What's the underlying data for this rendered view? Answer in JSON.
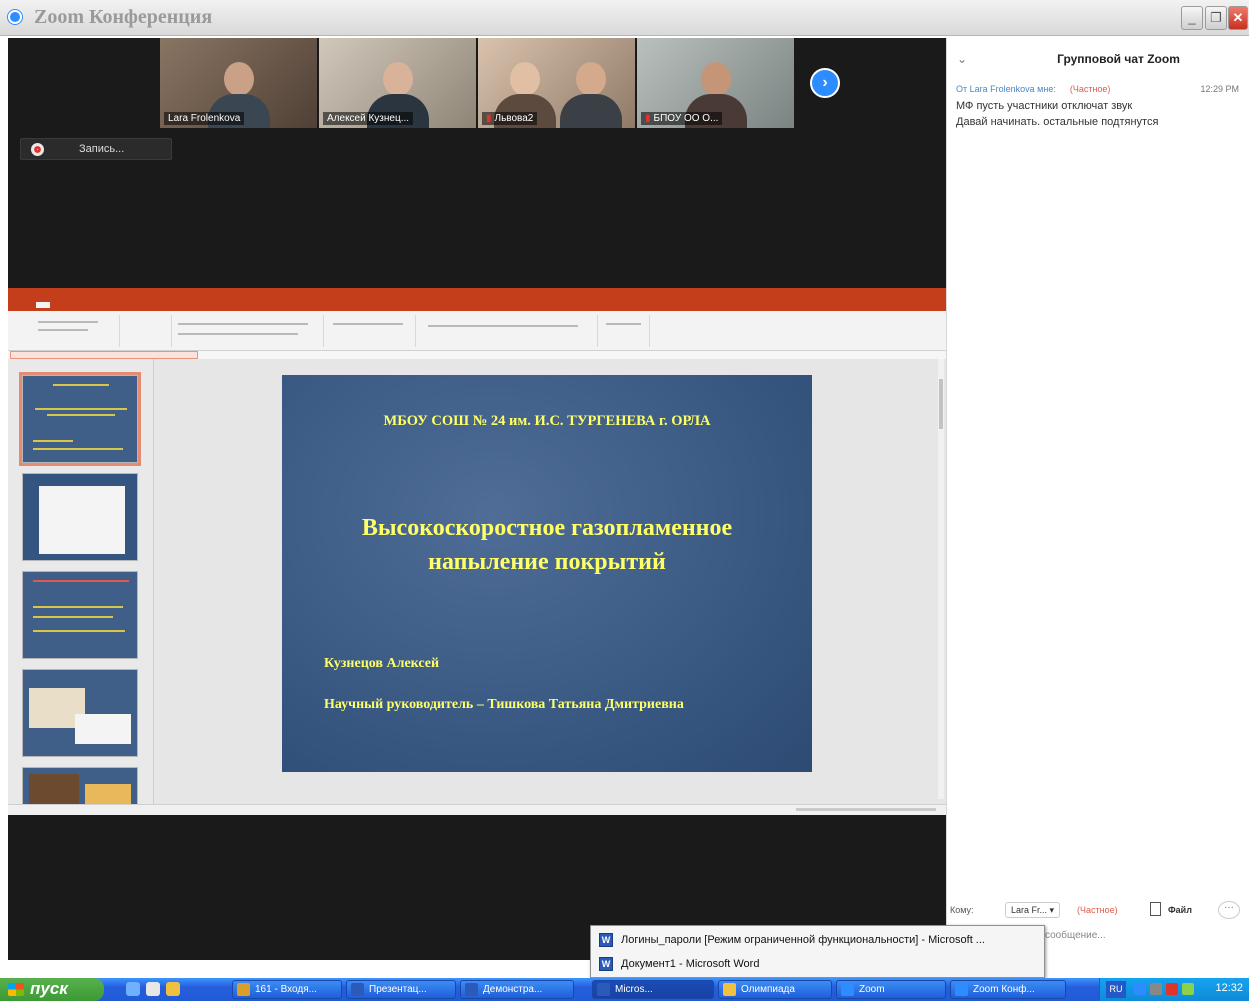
{
  "window": {
    "title": "Zoom Конференция"
  },
  "participants": [
    {
      "name": "Lara Frolenkova",
      "muted": false,
      "bg": "#6d5a4b",
      "shirt": "#3a4652"
    },
    {
      "name": "Алексей Кузнец...",
      "muted": false,
      "bg": "#b7ad9f",
      "shirt": "#2a3540"
    },
    {
      "name": "Львова2",
      "muted": true,
      "bg": "#c6a98f",
      "shirt": "#5c4a3e"
    },
    {
      "name": "БПОУ ОО О...",
      "muted": true,
      "bg": "#9fa7a6",
      "shirt": "#4a3a36"
    }
  ],
  "recording": {
    "label": "Запись..."
  },
  "slide": {
    "school": "МБОУ СОШ № 24 им. И.С. ТУРГЕНЕВА г. ОРЛА",
    "title_line1": "Высокоскоростное газопламенное",
    "title_line2": "напыление покрытий",
    "author": "Кузнецов Алексей",
    "supervisor": "Научный руководитель – Тишкова Татьяна Дмитриевна"
  },
  "chat": {
    "header": "Групповой чат Zoom",
    "from": "От Lara Frolenkova мне:",
    "private_tag": "(Частное)",
    "time": "12:29 PM",
    "messages": [
      "МФ пусть участники отключат звук",
      "Давай начинать. остальные подтянутся"
    ],
    "to_label": "Кому:",
    "to_value": "Lara Fr...",
    "to_private": "(Частное)",
    "file_label": "Файл",
    "more": "···",
    "input_placeholder": "сообщение..."
  },
  "popup": {
    "items": [
      "Логины_пароли [Режим ограниченной функциональности] - Microsoft ...",
      "Документ1 - Microsoft Word"
    ]
  },
  "taskbar": {
    "start": "пуск",
    "items": [
      {
        "label": "161 - Входя...",
        "icon": "#d8a02a"
      },
      {
        "label": "Презентац...",
        "icon": "#2b5bb8"
      },
      {
        "label": "Демонстра...",
        "icon": "#2b5bb8"
      },
      {
        "label": "Micros...",
        "icon": "#2b5bb8",
        "active": true
      },
      {
        "label": "Олимпиада",
        "icon": "#f0c040"
      },
      {
        "label": "Zoom",
        "icon": "#2d8cff"
      },
      {
        "label": "Zoom Конф...",
        "icon": "#2d8cff"
      }
    ],
    "lang": "RU",
    "clock": "12:32"
  }
}
